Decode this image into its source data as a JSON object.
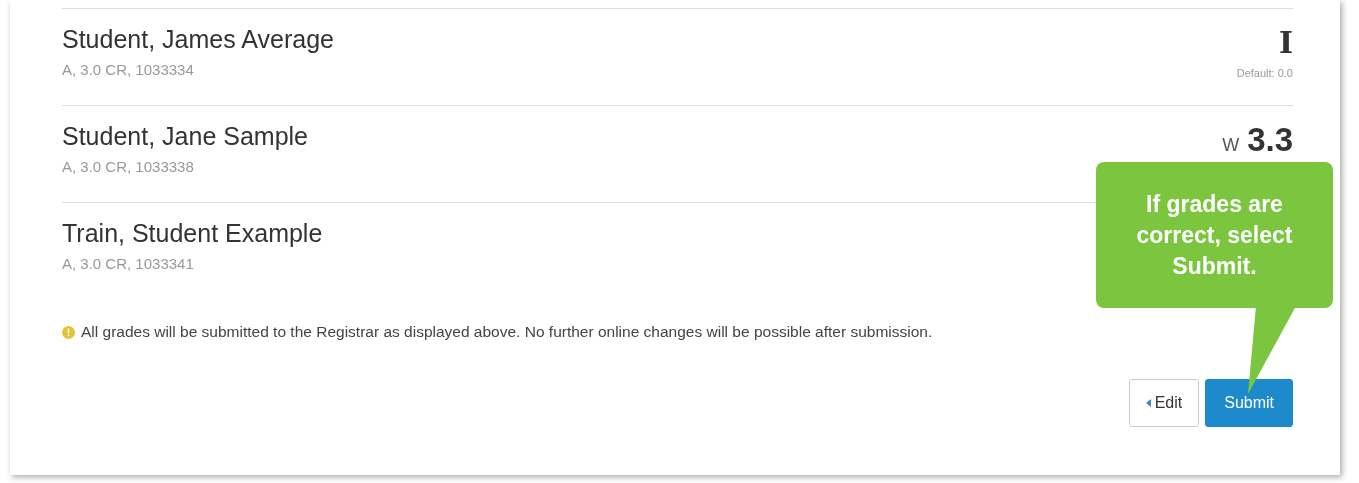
{
  "students": [
    {
      "name": "Student, James Average",
      "details": "A, 3.0 CR, 1033334",
      "grade": "I",
      "kind": "letter",
      "note": "Default: 0.0"
    },
    {
      "name": "Student, Jane Sample",
      "details": "A, 3.0 CR, 1033338",
      "grade": "3.3",
      "kind": "number",
      "prefix": "W"
    },
    {
      "name": "Train, Student Example",
      "details": "A, 3.0 CR, 1033341",
      "kind": "none"
    }
  ],
  "notice": "All grades will be submitted to the Registrar as displayed above. No further online changes will be possible after submission.",
  "buttons": [
    {
      "label": "Edit",
      "kind": "back"
    },
    {
      "label": "Submit",
      "kind": "primary"
    }
  ],
  "callout": {
    "text": "If grades are correct, select Submit."
  }
}
